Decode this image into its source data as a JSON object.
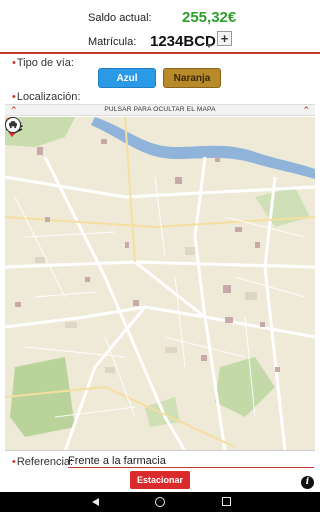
{
  "header": {
    "balance_label": "Saldo actual:",
    "balance_value": "255,32€",
    "plate_label": "Matrícula:",
    "plate_value": "1234BCD",
    "add_symbol": "+"
  },
  "road_type": {
    "label": "Tipo de vía:",
    "options": [
      "Azul",
      "Naranja"
    ],
    "colors": {
      "azul": "#2b9ae6",
      "naranja": "#b88a2a"
    }
  },
  "location": {
    "label": "Localización:",
    "map_bar_text": "PULSAR PARA OCULTAR EL MAPA",
    "icons": [
      "layers-icon",
      "locate-icon",
      "car-icon",
      "map-pin-icon",
      "chevron-up-icon"
    ]
  },
  "reference": {
    "label": "Referencia:",
    "value": "Frente a la farmacia"
  },
  "actions": {
    "park_label": "Estacionar",
    "info_symbol": "i"
  },
  "colors": {
    "accent": "#c0392b",
    "balance": "#2e9e2e",
    "park_button": "#d92b2b"
  }
}
